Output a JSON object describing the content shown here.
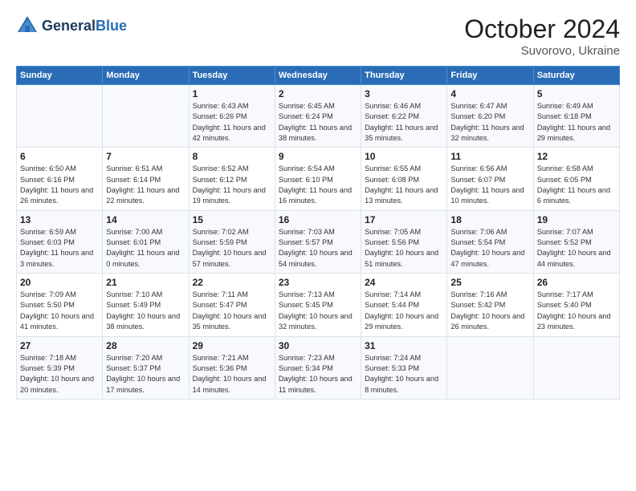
{
  "header": {
    "logo_line1": "General",
    "logo_line2": "Blue",
    "month": "October 2024",
    "location": "Suvorovo, Ukraine"
  },
  "days_of_week": [
    "Sunday",
    "Monday",
    "Tuesday",
    "Wednesday",
    "Thursday",
    "Friday",
    "Saturday"
  ],
  "weeks": [
    [
      {
        "day": "",
        "info": ""
      },
      {
        "day": "",
        "info": ""
      },
      {
        "day": "1",
        "info": "Sunrise: 6:43 AM\nSunset: 6:26 PM\nDaylight: 11 hours and 42 minutes."
      },
      {
        "day": "2",
        "info": "Sunrise: 6:45 AM\nSunset: 6:24 PM\nDaylight: 11 hours and 38 minutes."
      },
      {
        "day": "3",
        "info": "Sunrise: 6:46 AM\nSunset: 6:22 PM\nDaylight: 11 hours and 35 minutes."
      },
      {
        "day": "4",
        "info": "Sunrise: 6:47 AM\nSunset: 6:20 PM\nDaylight: 11 hours and 32 minutes."
      },
      {
        "day": "5",
        "info": "Sunrise: 6:49 AM\nSunset: 6:18 PM\nDaylight: 11 hours and 29 minutes."
      }
    ],
    [
      {
        "day": "6",
        "info": "Sunrise: 6:50 AM\nSunset: 6:16 PM\nDaylight: 11 hours and 26 minutes."
      },
      {
        "day": "7",
        "info": "Sunrise: 6:51 AM\nSunset: 6:14 PM\nDaylight: 11 hours and 22 minutes."
      },
      {
        "day": "8",
        "info": "Sunrise: 6:52 AM\nSunset: 6:12 PM\nDaylight: 11 hours and 19 minutes."
      },
      {
        "day": "9",
        "info": "Sunrise: 6:54 AM\nSunset: 6:10 PM\nDaylight: 11 hours and 16 minutes."
      },
      {
        "day": "10",
        "info": "Sunrise: 6:55 AM\nSunset: 6:08 PM\nDaylight: 11 hours and 13 minutes."
      },
      {
        "day": "11",
        "info": "Sunrise: 6:56 AM\nSunset: 6:07 PM\nDaylight: 11 hours and 10 minutes."
      },
      {
        "day": "12",
        "info": "Sunrise: 6:58 AM\nSunset: 6:05 PM\nDaylight: 11 hours and 6 minutes."
      }
    ],
    [
      {
        "day": "13",
        "info": "Sunrise: 6:59 AM\nSunset: 6:03 PM\nDaylight: 11 hours and 3 minutes."
      },
      {
        "day": "14",
        "info": "Sunrise: 7:00 AM\nSunset: 6:01 PM\nDaylight: 11 hours and 0 minutes."
      },
      {
        "day": "15",
        "info": "Sunrise: 7:02 AM\nSunset: 5:59 PM\nDaylight: 10 hours and 57 minutes."
      },
      {
        "day": "16",
        "info": "Sunrise: 7:03 AM\nSunset: 5:57 PM\nDaylight: 10 hours and 54 minutes."
      },
      {
        "day": "17",
        "info": "Sunrise: 7:05 AM\nSunset: 5:56 PM\nDaylight: 10 hours and 51 minutes."
      },
      {
        "day": "18",
        "info": "Sunrise: 7:06 AM\nSunset: 5:54 PM\nDaylight: 10 hours and 47 minutes."
      },
      {
        "day": "19",
        "info": "Sunrise: 7:07 AM\nSunset: 5:52 PM\nDaylight: 10 hours and 44 minutes."
      }
    ],
    [
      {
        "day": "20",
        "info": "Sunrise: 7:09 AM\nSunset: 5:50 PM\nDaylight: 10 hours and 41 minutes."
      },
      {
        "day": "21",
        "info": "Sunrise: 7:10 AM\nSunset: 5:49 PM\nDaylight: 10 hours and 38 minutes."
      },
      {
        "day": "22",
        "info": "Sunrise: 7:11 AM\nSunset: 5:47 PM\nDaylight: 10 hours and 35 minutes."
      },
      {
        "day": "23",
        "info": "Sunrise: 7:13 AM\nSunset: 5:45 PM\nDaylight: 10 hours and 32 minutes."
      },
      {
        "day": "24",
        "info": "Sunrise: 7:14 AM\nSunset: 5:44 PM\nDaylight: 10 hours and 29 minutes."
      },
      {
        "day": "25",
        "info": "Sunrise: 7:16 AM\nSunset: 5:42 PM\nDaylight: 10 hours and 26 minutes."
      },
      {
        "day": "26",
        "info": "Sunrise: 7:17 AM\nSunset: 5:40 PM\nDaylight: 10 hours and 23 minutes."
      }
    ],
    [
      {
        "day": "27",
        "info": "Sunrise: 7:18 AM\nSunset: 5:39 PM\nDaylight: 10 hours and 20 minutes."
      },
      {
        "day": "28",
        "info": "Sunrise: 7:20 AM\nSunset: 5:37 PM\nDaylight: 10 hours and 17 minutes."
      },
      {
        "day": "29",
        "info": "Sunrise: 7:21 AM\nSunset: 5:36 PM\nDaylight: 10 hours and 14 minutes."
      },
      {
        "day": "30",
        "info": "Sunrise: 7:23 AM\nSunset: 5:34 PM\nDaylight: 10 hours and 11 minutes."
      },
      {
        "day": "31",
        "info": "Sunrise: 7:24 AM\nSunset: 5:33 PM\nDaylight: 10 hours and 8 minutes."
      },
      {
        "day": "",
        "info": ""
      },
      {
        "day": "",
        "info": ""
      }
    ]
  ]
}
